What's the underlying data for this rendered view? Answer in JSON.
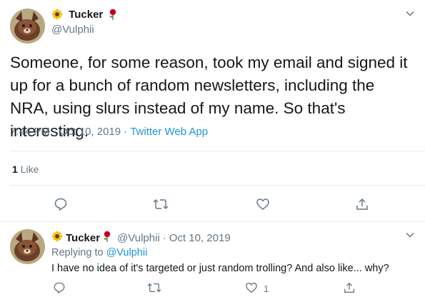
{
  "tweet": {
    "display_name": "Tucker",
    "handle": "@Vulphii",
    "text": "Someone, for some reason, took my email and signed it up for a bunch of random newsletters, including the NRA, using slurs instead of my name. So that's interesting.",
    "time": "7:44 PM",
    "date": "Oct 10, 2019",
    "source": "Twitter Web App",
    "like_count": "1",
    "like_label": "Like"
  },
  "reply": {
    "display_name": "Tucker",
    "handle": "@Vulphii",
    "date": "Oct 10, 2019",
    "replying_label": "Replying to",
    "replying_to": "@Vulphii",
    "text": "I have no idea of it's targeted or just random trolling? And also like... why?",
    "like_count": "1"
  },
  "colors": {
    "accent": "#1b95e0",
    "muted": "#657786",
    "text": "#14171a",
    "divider": "#e6ecf0"
  },
  "icons": [
    "sunflower-icon",
    "rose-icon",
    "chevron-down-icon",
    "reply-icon",
    "retweet-icon",
    "heart-icon",
    "share-icon"
  ]
}
